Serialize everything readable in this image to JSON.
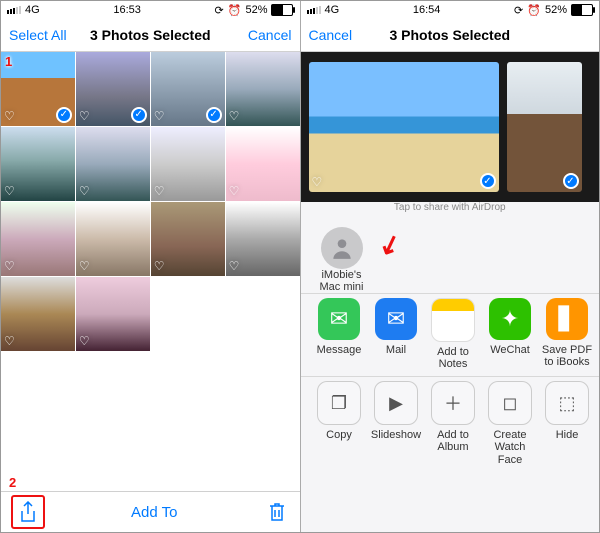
{
  "left": {
    "status": {
      "net": "4G",
      "time": "16:53",
      "alarm": "⏰",
      "battPct": "52%",
      "battFill": 52
    },
    "nav": {
      "selectAll": "Select All",
      "title": "3 Photos Selected",
      "cancel": "Cancel"
    },
    "step1": "1",
    "step2": "2",
    "toolbar": {
      "addTo": "Add To"
    }
  },
  "right": {
    "status": {
      "net": "4G",
      "time": "16:54",
      "alarm": "⏰",
      "battPct": "52%",
      "battFill": 52
    },
    "nav": {
      "cancel": "Cancel",
      "title": "3 Photos Selected"
    },
    "airdrop": {
      "tag": "Tap to share with AirDrop",
      "target": "iMobie's\nMac mini"
    },
    "apps": [
      {
        "name": "Message"
      },
      {
        "name": "Mail"
      },
      {
        "name": "Add to Notes"
      },
      {
        "name": "WeChat"
      },
      {
        "name": "Save PDF\nto iBooks"
      }
    ],
    "actions": [
      {
        "name": "Copy"
      },
      {
        "name": "Slideshow"
      },
      {
        "name": "Add to Album"
      },
      {
        "name": "Create\nWatch Face"
      },
      {
        "name": "Hide"
      }
    ]
  }
}
